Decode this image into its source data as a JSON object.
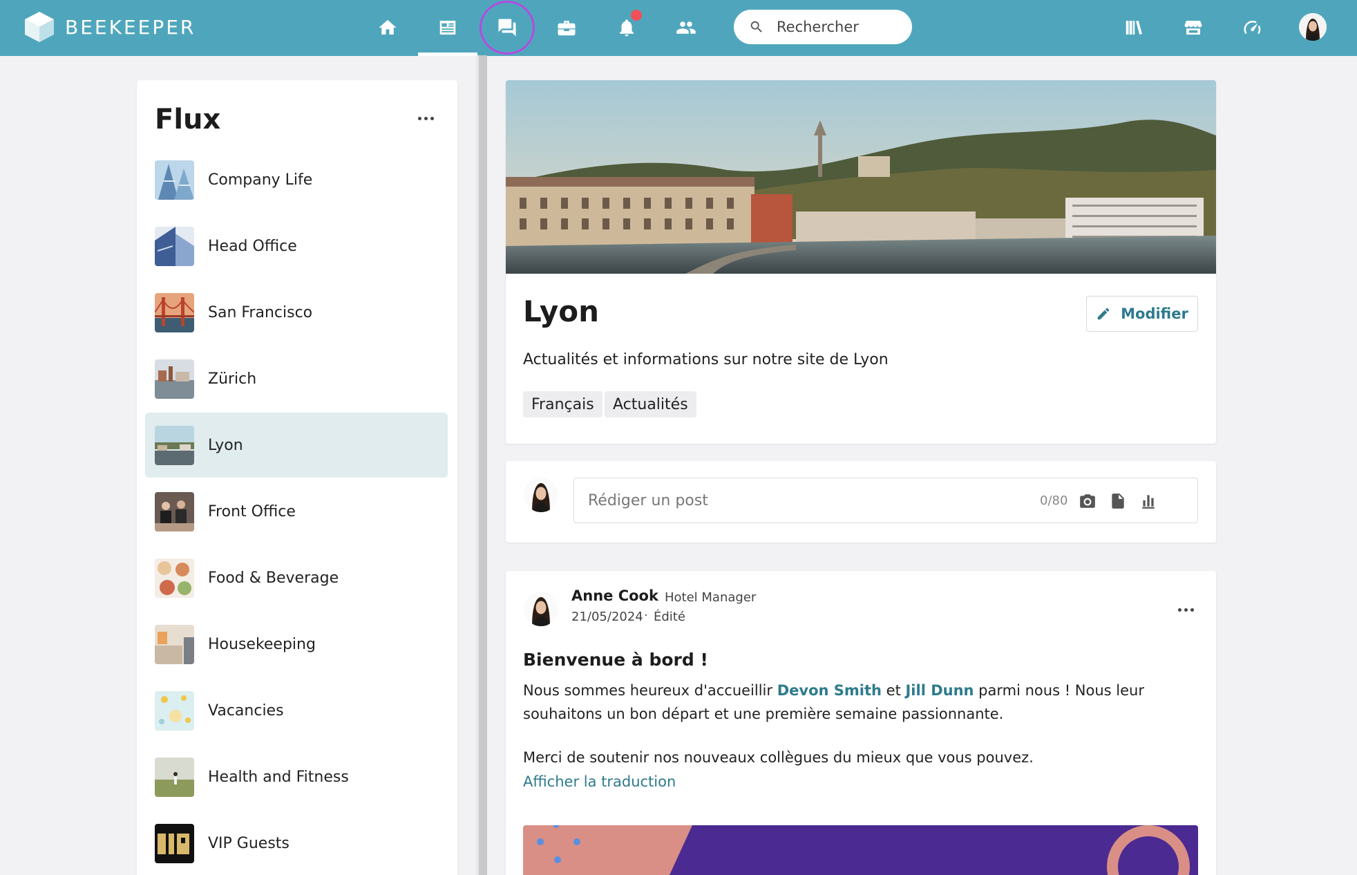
{
  "app": {
    "brand": "BEEKEEPER",
    "brand_color": "#4fa6bc",
    "accent_color": "#2d7b8c"
  },
  "topnav": {
    "items": [
      {
        "icon": "home-icon"
      },
      {
        "icon": "news-feed-icon",
        "active": true
      },
      {
        "icon": "chat-icon",
        "highlighted": true
      },
      {
        "icon": "toolbox-icon"
      },
      {
        "icon": "bell-icon",
        "has_notification": true
      },
      {
        "icon": "people-icon"
      }
    ],
    "search_placeholder": "Rechercher",
    "right_icons": [
      "library-icon",
      "marketplace-icon",
      "dashboard-gauge-icon",
      "profile-avatar"
    ]
  },
  "sidebar": {
    "title": "Flux",
    "items": [
      {
        "label": "Company Life"
      },
      {
        "label": "Head Office"
      },
      {
        "label": "San Francisco"
      },
      {
        "label": "Zürich"
      },
      {
        "label": "Lyon",
        "active": true
      },
      {
        "label": "Front Office"
      },
      {
        "label": "Food & Beverage"
      },
      {
        "label": "Housekeeping"
      },
      {
        "label": "Vacancies"
      },
      {
        "label": "Health and Fitness"
      },
      {
        "label": "VIP Guests"
      }
    ]
  },
  "group": {
    "title": "Lyon",
    "edit_label": "Modifier",
    "description": "Actualités et informations sur notre site de Lyon",
    "tags": [
      "Français",
      "Actualités"
    ]
  },
  "composer": {
    "placeholder": "Rédiger un post",
    "char_count": "0/80"
  },
  "post": {
    "author": "Anne Cook",
    "separator": "·",
    "role": "Hotel Manager",
    "date": "21/05/2024",
    "edited": "Édité",
    "title": "Bienvenue à bord !",
    "body_prefix": "Nous sommes heureux d'accueillir ",
    "mention1": "Devon Smith",
    "body_mid": " et ",
    "mention2": "Jill Dunn",
    "body_suffix": " parmi nous ! Nous leur souhaitons un bon départ et une première semaine passionnante.",
    "body_second": "Merci de soutenir nos nouveaux collègues du mieux que vous pouvez.",
    "translate_label": "Afficher la traduction"
  }
}
